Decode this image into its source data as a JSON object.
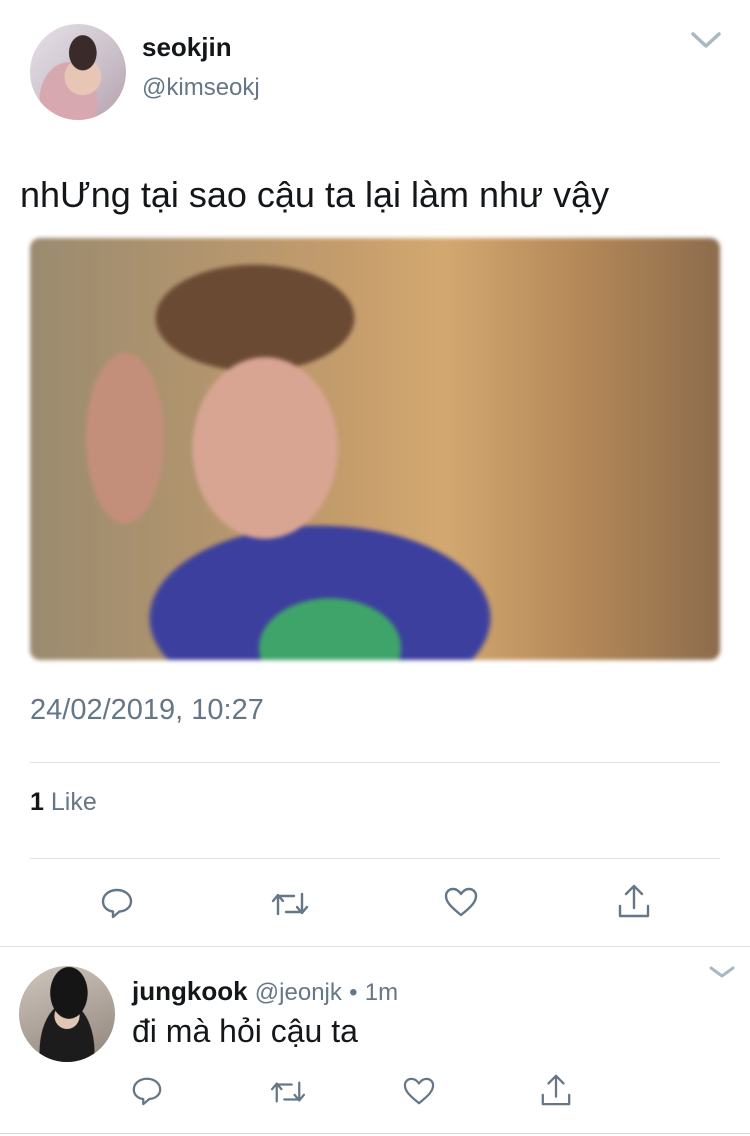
{
  "tweet": {
    "author_name": "seokjin",
    "author_handle": "@kimseokj",
    "text": "nhƯng tại sao cậu ta lại làm như vậy",
    "timestamp": "24/02/2019, 10:27",
    "like_count": "1",
    "like_label": "Like"
  },
  "reply": {
    "author_name": "jungkook",
    "author_handle": "@jeonjk",
    "separator": "•",
    "time": "1m",
    "text": "đi mà hỏi cậu ta"
  },
  "icons": {
    "reply": "reply-icon",
    "retweet": "retweet-icon",
    "like": "heart-icon",
    "share": "share-icon",
    "more": "chevron-down-icon"
  },
  "colors": {
    "text": "#14171a",
    "secondary": "#657786",
    "divider": "#dfe3e7"
  }
}
